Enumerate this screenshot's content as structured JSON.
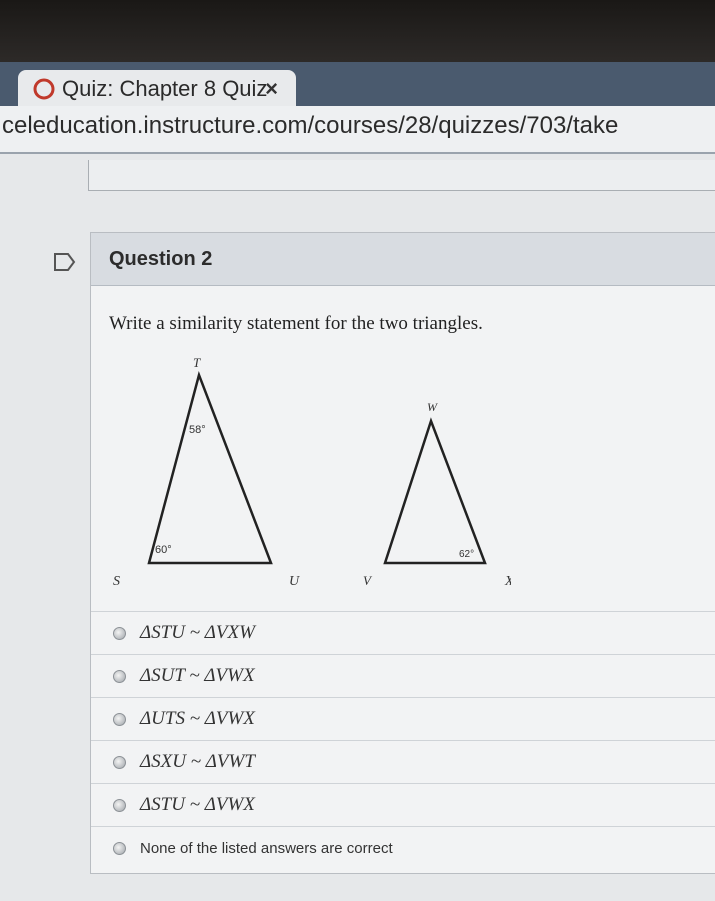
{
  "browser": {
    "tab_title": "Quiz: Chapter 8 Quiz",
    "tab_close": "×",
    "url": "celeducation.instructure.com/courses/28/quizzes/703/take"
  },
  "question": {
    "title": "Question 2",
    "prompt": "Write a similarity statement for the two triangles."
  },
  "figure": {
    "triangle1": {
      "vertices": [
        "T",
        "S",
        "U"
      ],
      "angles": [
        "58°",
        "60°"
      ]
    },
    "triangle2": {
      "vertices": [
        "W",
        "V",
        "X"
      ],
      "angles": [
        "62°"
      ]
    }
  },
  "answers": [
    {
      "label": "ΔSTU ~ ΔVXW",
      "style": "math"
    },
    {
      "label": "ΔSUT ~ ΔVWX",
      "style": "math"
    },
    {
      "label": "ΔUTS ~ ΔVWX",
      "style": "math"
    },
    {
      "label": "ΔSXU ~ ΔVWT",
      "style": "math"
    },
    {
      "label": "ΔSTU ~ ΔVWX",
      "style": "math"
    },
    {
      "label": "None of the listed answers are correct",
      "style": "text"
    }
  ],
  "colors": {
    "tab_strip": "#4a5a6e",
    "header": "#d8dce1",
    "card": "#f2f3f4"
  }
}
